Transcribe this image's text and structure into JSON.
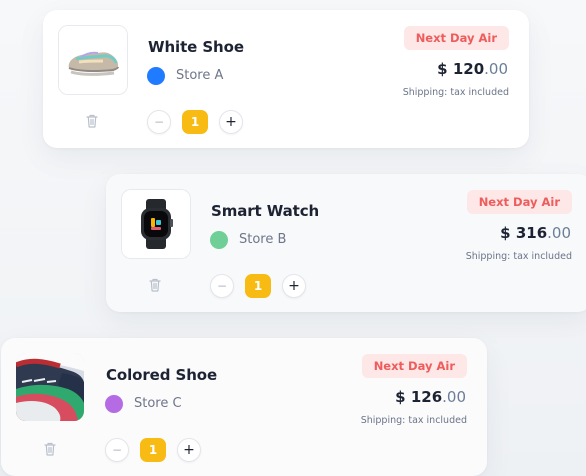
{
  "cart_items": [
    {
      "title": "White Shoe",
      "store": "Store A",
      "store_color": "#1f7bff",
      "shipping": "Next Day Air",
      "currency": "$",
      "price_whole": "120",
      "price_cents": ".00",
      "note": "Shipping: tax included",
      "quantity": "1",
      "image": "white-shoe-image"
    },
    {
      "title": "Smart Watch",
      "store": "Store B",
      "store_color": "#6fcf97",
      "shipping": "Next Day Air",
      "currency": "$",
      "price_whole": "316",
      "price_cents": ".00",
      "note": "Shipping: tax included",
      "quantity": "1",
      "image": "smart-watch-image"
    },
    {
      "title": "Colored Shoe",
      "store": "Store C",
      "store_color": "#b46be3",
      "shipping": "Next Day Air",
      "currency": "$",
      "price_whole": "126",
      "price_cents": ".00",
      "note": "Shipping: tax included",
      "quantity": "1",
      "image": "colored-shoe-image"
    }
  ],
  "controls": {
    "minus": "−",
    "plus": "+",
    "trash_icon": "trash-icon"
  },
  "colors": {
    "badge_bg": "#fde7e7",
    "badge_text": "#ee5c5c",
    "quantity_bg": "#f8bb14",
    "price_text": "#1d2333",
    "cents_text": "#6b7e98"
  }
}
